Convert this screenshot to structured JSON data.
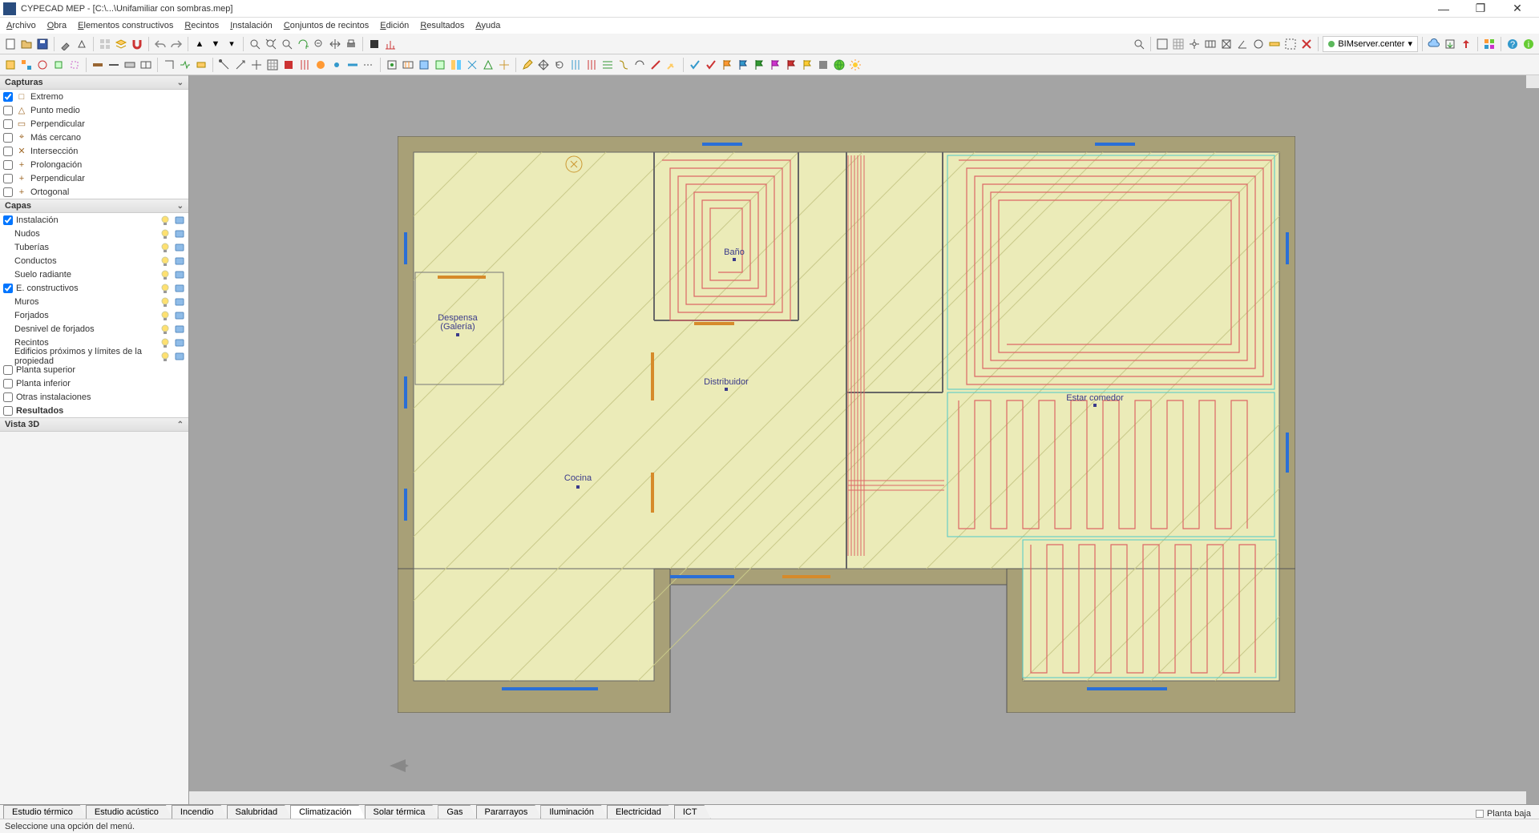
{
  "title": "CYPECAD MEP - [C:\\...\\Unifamiliar con sombras.mep]",
  "menu": [
    "Archivo",
    "Obra",
    "Elementos constructivos",
    "Recintos",
    "Instalación",
    "Conjuntos de recintos",
    "Edición",
    "Resultados",
    "Ayuda"
  ],
  "bimserver": "BIMserver.center",
  "panels": {
    "capturas": {
      "title": "Capturas",
      "items": [
        {
          "label": "Extremo",
          "checked": true,
          "sym": "□"
        },
        {
          "label": "Punto medio",
          "checked": false,
          "sym": "△"
        },
        {
          "label": "Perpendicular",
          "checked": false,
          "sym": "▭"
        },
        {
          "label": "Más cercano",
          "checked": false,
          "sym": "⌖"
        },
        {
          "label": "Intersección",
          "checked": false,
          "sym": "✕"
        },
        {
          "label": "Prolongación",
          "checked": false,
          "sym": "+"
        },
        {
          "label": "Perpendicular",
          "checked": false,
          "sym": "+"
        },
        {
          "label": "Ortogonal",
          "checked": false,
          "sym": "+"
        }
      ]
    },
    "capas": {
      "title": "Capas",
      "groups": [
        {
          "label": "Instalación",
          "checked": true,
          "children": [
            "Nudos",
            "Tuberías",
            "Conductos",
            "Suelo radiante"
          ]
        },
        {
          "label": "E. constructivos",
          "checked": true,
          "children": [
            "Muros",
            "Forjados",
            "Desnivel de forjados",
            "Recintos",
            "Edificios próximos y límites de la propiedad"
          ]
        }
      ],
      "flat": [
        {
          "label": "Planta superior",
          "checked": false
        },
        {
          "label": "Planta inferior",
          "checked": false
        },
        {
          "label": "Otras instalaciones",
          "checked": false
        }
      ],
      "resultados": "Resultados"
    },
    "vista3d": {
      "title": "Vista 3D"
    }
  },
  "rooms": {
    "cocina": "Cocina",
    "despensa1": "Despensa",
    "despensa2": "(Galería)",
    "bano": "Baño",
    "distribuidor": "Distribuidor",
    "estar": "Estar comedor"
  },
  "tabs": [
    "Estudio térmico",
    "Estudio acústico",
    "Incendio",
    "Salubridad",
    "Climatización",
    "Solar térmica",
    "Gas",
    "Pararrayos",
    "Iluminación",
    "Electricidad",
    "ICT"
  ],
  "activeTab": 4,
  "floor": "Planta baja",
  "status": "Seleccione una opción del menú."
}
